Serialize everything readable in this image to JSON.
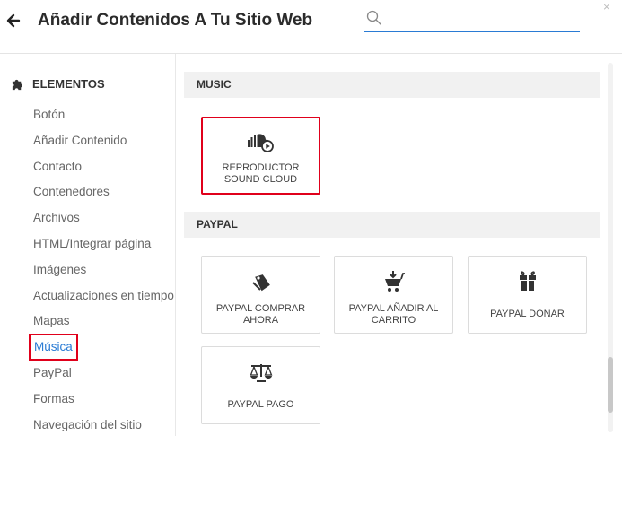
{
  "header": {
    "title": "Añadir Contenidos A Tu Sitio Web",
    "search_placeholder": "",
    "close_label": "×",
    "back_icon": "arrow-left-icon",
    "search_icon": "search-icon"
  },
  "sidebar": {
    "heading": "ELEMENTOS",
    "heading_icon": "puzzle-icon",
    "items": [
      {
        "label": "Botón"
      },
      {
        "label": "Añadir Contenido"
      },
      {
        "label": "Contacto"
      },
      {
        "label": "Contenedores"
      },
      {
        "label": "Archivos"
      },
      {
        "label": "HTML/Integrar página"
      },
      {
        "label": "Imágenes"
      },
      {
        "label": "Actualizaciones en tiempo"
      },
      {
        "label": "Mapas"
      },
      {
        "label": "Música",
        "active": true
      },
      {
        "label": "PayPal"
      },
      {
        "label": "Formas"
      },
      {
        "label": "Navegación del sitio"
      }
    ]
  },
  "sections": [
    {
      "title": "MUSIC",
      "cards": [
        {
          "label": "REPRODUCTOR SOUND CLOUD",
          "icon": "soundcloud-play-icon",
          "selected": true
        }
      ]
    },
    {
      "title": "PAYPAL",
      "cards": [
        {
          "label": "PAYPAL COMPRAR AHORA",
          "icon": "price-tag-icon"
        },
        {
          "label": "PAYPAL AÑADIR AL CARRITO",
          "icon": "cart-add-icon"
        },
        {
          "label": "PAYPAL DONAR",
          "icon": "gift-icon"
        },
        {
          "label": "PAYPAL PAGO",
          "icon": "scale-icon"
        }
      ]
    }
  ],
  "colors": {
    "accent": "#2a7bd4",
    "highlight": "#e0001b",
    "section_bg": "#f1f1f1"
  }
}
